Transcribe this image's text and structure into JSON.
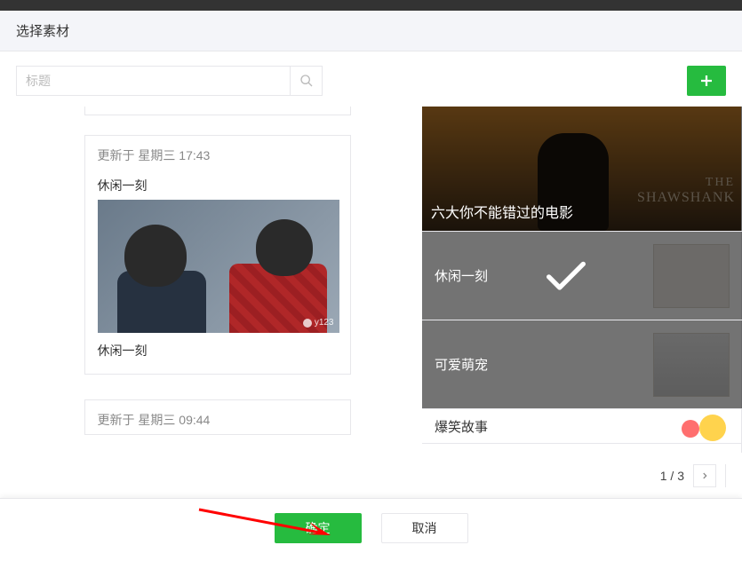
{
  "header": {
    "title": "选择素材"
  },
  "search": {
    "placeholder": "标题"
  },
  "left": {
    "card1": {
      "updated": "更新于 星期三 17:43",
      "title": "休闲一刻",
      "subtitle": "休闲一刻",
      "watermark": "y123"
    },
    "card2": {
      "updated": "更新于 星期三 09:44"
    }
  },
  "right": {
    "hero_caption": "六大你不能错过的电影",
    "hero_brand_top": "THE",
    "hero_brand_mid": "SHAWSHANK",
    "rows": [
      {
        "label": "休闲一刻",
        "selected": true
      },
      {
        "label": "可爱萌宠",
        "selected": false
      },
      {
        "label": "爆笑故事",
        "selected": false
      }
    ]
  },
  "pager": {
    "current": "1",
    "sep": "/",
    "total": "3"
  },
  "footer": {
    "ok": "确定",
    "cancel": "取消"
  }
}
